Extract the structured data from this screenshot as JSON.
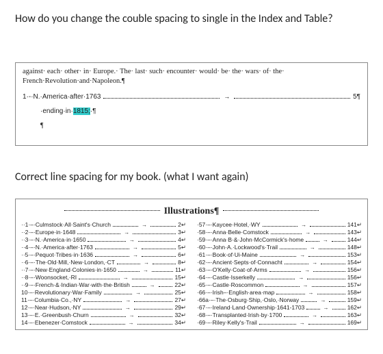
{
  "question": "How do you change the couble spacing to single in the Index and Table?",
  "sample": {
    "paragraph": "against· each· other· in· Europe.· The· last· such· encounter· would· be· the· wars· of· the· French·Revolution·and·Napoleon.¶",
    "toc1_label": "1·-·N.·America·after·1763",
    "toc1_tab": "→",
    "toc1_page": "5¶",
    "toc2_prefix": "·ending·in·",
    "toc2_highlight": "1815;",
    "toc2_suffix": "·¶",
    "lone_para": "¶"
  },
  "note2": "Correct line spacing for my book. (what I want again)",
  "illus": {
    "title": "Illustrations¶",
    "left": [
      {
        "n": "··1·–·",
        "t": "Culmstock·All·Saint's·Church",
        "p": "2"
      },
      {
        "n": "··2·–·",
        "t": "Europe·in·1648",
        "p": "3"
      },
      {
        "n": "··3·–·",
        "t": "N.·America·in·1650",
        "p": "4"
      },
      {
        "n": "··4·–·",
        "t": "N.·America·after·1763",
        "p": "5"
      },
      {
        "n": "··5·–·",
        "t": "Pequot·Tribes·in·1636",
        "p": "6"
      },
      {
        "n": "··6·–·",
        "t": "The·Old·Mill,·New·London,·CT",
        "p": "8"
      },
      {
        "n": "··7·–·",
        "t": "New·England·Colonies·in·1650",
        "p": "11"
      },
      {
        "n": "··8·–·",
        "t": "Woonsocket,·RI",
        "p": "15"
      },
      {
        "n": "··9·–·",
        "t": "French·&·Indian·War·with·the·British",
        "p": "22"
      },
      {
        "n": "10·–·",
        "t": "Revolutionary·War·Family",
        "p": "25"
      },
      {
        "n": "11·–·",
        "t": "Columbia·Co.,·NY",
        "p": "27"
      },
      {
        "n": "12·–·",
        "t": "Near·Hudson,·NY",
        "p": "29"
      },
      {
        "n": "13·–·",
        "t": "E.·Greenbush·Churn",
        "p": "32"
      },
      {
        "n": "14·–·",
        "t": "Ebenezer·Comstock",
        "p": "34"
      }
    ],
    "right": [
      {
        "n": "·57·–·",
        "t": "Kaycee·Hotel,·WY",
        "p": "141"
      },
      {
        "n": "·58·–·",
        "t": "Anna·Belle·Comstock",
        "p": "143"
      },
      {
        "n": "·59·–·",
        "t": "Anna·B·&·John·McCormick's·home",
        "p": "144"
      },
      {
        "n": "·60·–·",
        "t": "John·A.·Lockwood's·Trail",
        "p": "148"
      },
      {
        "n": "·61·–·",
        "t": "Book·of·Ui-Maine",
        "p": "153"
      },
      {
        "n": "·62·–·",
        "t": "Ancient·Septs·of·Connacht",
        "p": "154"
      },
      {
        "n": "·63·–·",
        "t": "O'Kelly·Coat·of·Arms",
        "p": "156"
      },
      {
        "n": "·64·–·",
        "t": "Castle·Isserkelly",
        "p": "156"
      },
      {
        "n": "·65·–·",
        "t": "Castle·Roscommon",
        "p": "157"
      },
      {
        "n": "·66·–·",
        "t": "Irish–·English·area·map",
        "p": "158"
      },
      {
        "n": "·66a·–·",
        "t": "The·Osburg·Ship,·Oslo,·Norway",
        "p": "159"
      },
      {
        "n": "·67·–·",
        "t": "Ireland·Land·Ownership·1641-1703",
        "p": "162"
      },
      {
        "n": "·68·–·",
        "t": "Transplanted·Irish·by·1700",
        "p": "163"
      },
      {
        "n": "·69·–·",
        "t": "Riley·Kelly's·Trail",
        "p": "169"
      }
    ]
  }
}
